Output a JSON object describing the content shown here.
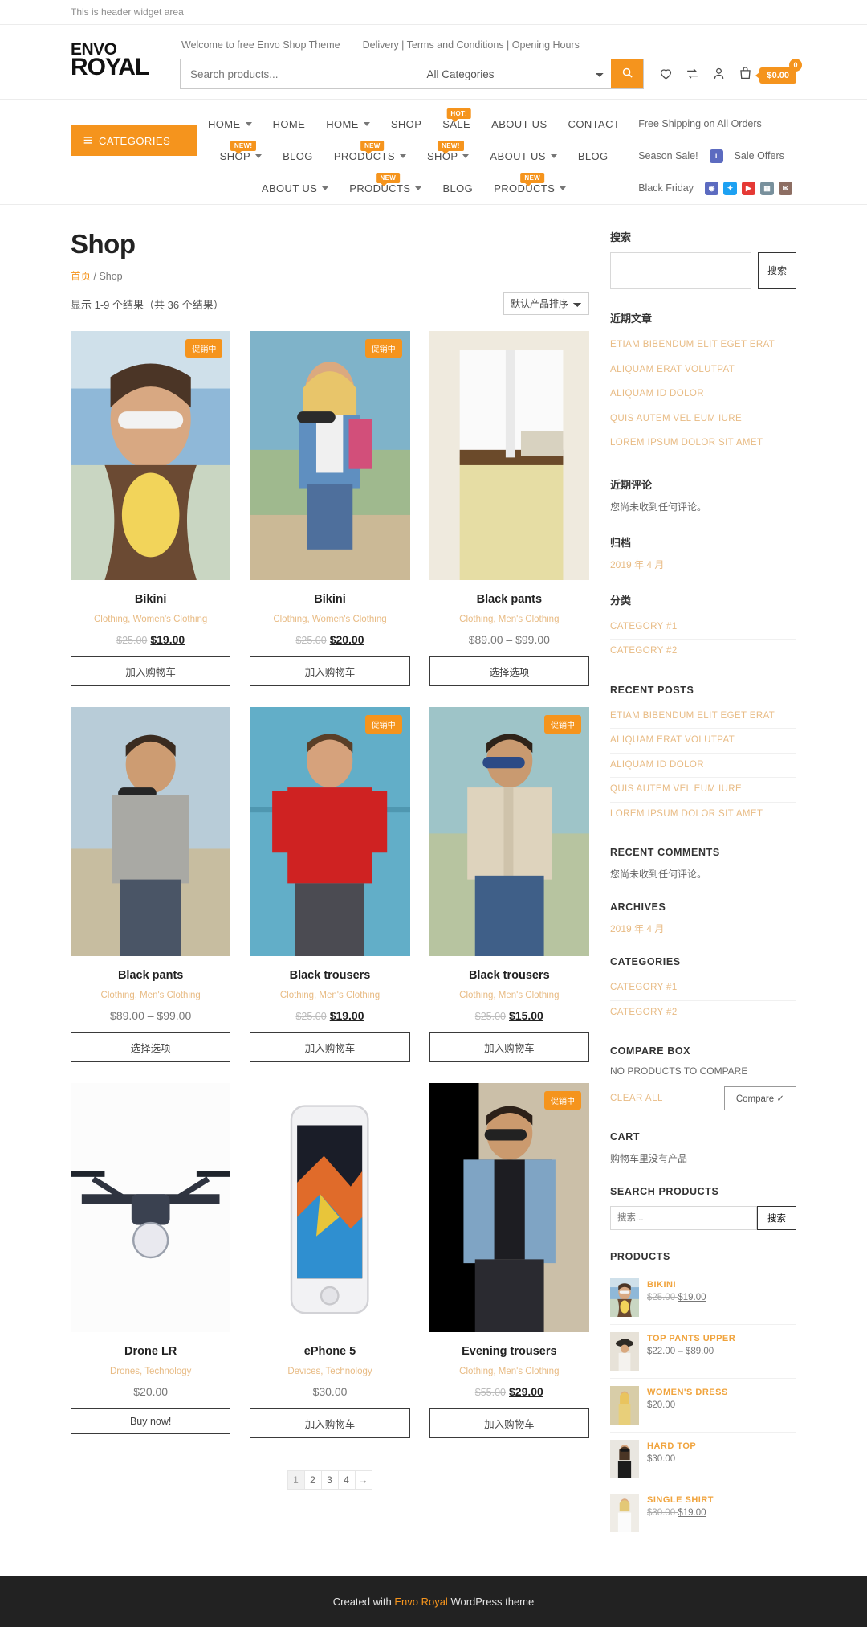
{
  "header_widget": {
    "text": "This is header widget area"
  },
  "logo": {
    "line1": "ENVO",
    "line2": "ROYAL"
  },
  "top_links": [
    {
      "label": "Welcome to free Envo Shop Theme"
    },
    {
      "label": "Delivery | Terms and Conditions | Opening Hours"
    }
  ],
  "search": {
    "placeholder": "Search products...",
    "category_selected": "All Categories",
    "button_icon": "search-icon"
  },
  "header_icons": {
    "wishlist": "heart-icon",
    "compare": "compare-icon",
    "account": "user-icon",
    "cart": "cart-icon",
    "cart_count": "0",
    "cart_total": "$0.00"
  },
  "categories_button": {
    "label": "CATEGORIES",
    "icon": "list-icon"
  },
  "nav": {
    "row1": [
      {
        "label": "HOME",
        "caret": true
      },
      {
        "label": "HOME",
        "caret": false
      },
      {
        "label": "HOME",
        "caret": true
      },
      {
        "label": "SHOP",
        "caret": false
      },
      {
        "label": "SALE",
        "caret": false,
        "badge": "HOT!"
      },
      {
        "label": "ABOUT US",
        "caret": false
      },
      {
        "label": "CONTACT",
        "caret": false
      }
    ],
    "row2": [
      {
        "label": "SHOP",
        "caret": true,
        "badge": "NEW!"
      },
      {
        "label": "BLOG",
        "caret": false
      },
      {
        "label": "PRODUCTS",
        "caret": true,
        "badge": "NEW"
      },
      {
        "label": "SHOP",
        "caret": true,
        "badge": "NEW!"
      },
      {
        "label": "ABOUT US",
        "caret": true
      },
      {
        "label": "BLOG",
        "caret": false
      }
    ],
    "row3": [
      {
        "label": "ABOUT US",
        "caret": true
      },
      {
        "label": "PRODUCTS",
        "caret": true,
        "badge": "NEW"
      },
      {
        "label": "BLOG",
        "caret": false
      },
      {
        "label": "PRODUCTS",
        "caret": true,
        "badge": "NEW"
      }
    ],
    "right1": [
      {
        "label": "Free Shipping on All Orders"
      }
    ],
    "right2": [
      {
        "label": "Season Sale!"
      },
      {
        "label": "Sale Offers"
      }
    ],
    "right3": [
      {
        "label": "Black Friday"
      }
    ],
    "social": [
      {
        "name": "instagram-icon",
        "glyph": "◉",
        "color": "#5c6bc0"
      },
      {
        "name": "twitter-icon",
        "glyph": "✦",
        "color": "#1da1f2"
      },
      {
        "name": "youtube-icon",
        "glyph": "▶",
        "color": "#e53935"
      },
      {
        "name": "rss-icon",
        "glyph": "▦",
        "color": "#78909c"
      },
      {
        "name": "mail-icon",
        "glyph": "✉",
        "color": "#8d6e63"
      }
    ]
  },
  "page": {
    "title": "Shop",
    "breadcrumb_home": "首页",
    "breadcrumb_sep": " / ",
    "breadcrumb_current": "Shop",
    "result_count": "显示 1-9 个结果（共 36 个结果）",
    "sort_selected": "默认产品排序"
  },
  "sale_badge_label": "促销中",
  "products": [
    {
      "name": "Bikini",
      "categories": "Clothing,  Women's Clothing",
      "price_old": "$25.00",
      "price_new": "$19.00",
      "price_range": "",
      "button": "加入购物车",
      "on_sale": true,
      "image": "woman-sunglasses-yellow-bikini"
    },
    {
      "name": "Bikini",
      "categories": "Clothing,  Women's Clothing",
      "price_old": "$25.00",
      "price_new": "$20.00",
      "price_range": "",
      "button": "加入购物车",
      "on_sale": true,
      "image": "blonde-woman-denim-beach"
    },
    {
      "name": "Black pants",
      "categories": "Clothing,  Men's Clothing",
      "price_old": "",
      "price_new": "",
      "price_range": "$89.00 – $99.00",
      "button": "选择选项",
      "on_sale": false,
      "image": "man-white-shirt-yellow-pants"
    },
    {
      "name": "Black pants",
      "categories": "Clothing,  Men's Clothing",
      "price_old": "",
      "price_new": "",
      "price_range": "$89.00 – $99.00",
      "button": "选择选项",
      "on_sale": false,
      "image": "man-grey-henley-beach"
    },
    {
      "name": "Black trousers",
      "categories": "Clothing,  Men's Clothing",
      "price_old": "$25.00",
      "price_new": "$19.00",
      "price_range": "",
      "button": "加入购物车",
      "on_sale": true,
      "image": "man-red-sweater-blue-wall"
    },
    {
      "name": "Black trousers",
      "categories": "Clothing,  Men's Clothing",
      "price_old": "$25.00",
      "price_new": "$15.00",
      "price_range": "",
      "button": "加入购物车",
      "on_sale": true,
      "image": "man-beige-shirt-sunglasses"
    },
    {
      "name": "Drone LR",
      "categories": "Drones,  Technology",
      "price_old": "",
      "price_new": "",
      "price_range": "$20.00",
      "button": "Buy now!",
      "on_sale": false,
      "image": "white-quadcopter-drone"
    },
    {
      "name": "ePhone 5",
      "categories": "Devices,  Technology",
      "price_old": "",
      "price_new": "",
      "price_range": "$30.00",
      "button": "加入购物车",
      "on_sale": false,
      "image": "white-smartphone-colorful-screen"
    },
    {
      "name": "Evening trousers",
      "categories": "Clothing,  Men's Clothing",
      "price_old": "$55.00",
      "price_new": "$29.00",
      "price_range": "",
      "button": "加入购物车",
      "on_sale": true,
      "image": "man-denim-jacket-sunglasses"
    }
  ],
  "pagination": {
    "pages": [
      "1",
      "2",
      "3",
      "4"
    ],
    "current": "1",
    "next_glyph": "→"
  },
  "sidebar": {
    "search_cn": {
      "title": "搜索",
      "value": "",
      "button": "搜索"
    },
    "recent_posts_cn": {
      "title": "近期文章",
      "items": [
        "ETIAM BIBENDUM ELIT EGET ERAT",
        "ALIQUAM ERAT VOLUTPAT",
        "ALIQUAM ID DOLOR",
        "QUIS AUTEM VEL EUM IURE",
        "LOREM IPSUM DOLOR SIT AMET"
      ]
    },
    "recent_comments_cn": {
      "title": "近期评论",
      "text": "您尚未收到任何评论。"
    },
    "archives_cn": {
      "title": "归档",
      "items": [
        "2019 年 4 月"
      ]
    },
    "categories_cn": {
      "title": "分类",
      "items": [
        "CATEGORY #1",
        "CATEGORY #2"
      ]
    },
    "recent_posts": {
      "title": "RECENT POSTS",
      "items": [
        "ETIAM BIBENDUM ELIT EGET ERAT",
        "ALIQUAM ERAT VOLUTPAT",
        "ALIQUAM ID DOLOR",
        "QUIS AUTEM VEL EUM IURE",
        "LOREM IPSUM DOLOR SIT AMET"
      ]
    },
    "recent_comments": {
      "title": "RECENT COMMENTS",
      "text": "您尚未收到任何评论。"
    },
    "archives": {
      "title": "ARCHIVES",
      "items": [
        "2019 年 4 月"
      ]
    },
    "categories": {
      "title": "CATEGORIES",
      "items": [
        "CATEGORY #1",
        "CATEGORY #2"
      ]
    },
    "compare_box": {
      "title": "COMPARE BOX",
      "empty_text": "NO PRODUCTS TO COMPARE",
      "clear_all": "CLEAR ALL",
      "compare_button": "Compare ✓"
    },
    "cart": {
      "title": "CART",
      "empty_text": "购物车里没有产品"
    },
    "search_products": {
      "title": "SEARCH PRODUCTS",
      "placeholder": "搜索...",
      "button": "搜索"
    },
    "products_widget": {
      "title": "PRODUCTS",
      "items": [
        {
          "name": "BIKINI",
          "price_old": "$25.00",
          "price_new": "$19.00",
          "price_plain": "",
          "image": "woman-sunglasses-yellow-bikini"
        },
        {
          "name": "TOP PANTS UPPER",
          "price_old": "",
          "price_new": "",
          "price_plain": "$22.00 – $89.00",
          "image": "woman-hat-white-top"
        },
        {
          "name": "WOMEN'S DRESS",
          "price_old": "",
          "price_new": "",
          "price_plain": "$20.00",
          "image": "blonde-woman-yellow-dress"
        },
        {
          "name": "HARD TOP",
          "price_old": "",
          "price_new": "",
          "price_plain": "$30.00",
          "image": "woman-sunglasses-black-top"
        },
        {
          "name": "SINGLE SHIRT",
          "price_old": "$30.00",
          "price_new": "$19.00",
          "price_plain": "",
          "image": "blonde-woman-white-shirt"
        }
      ]
    }
  },
  "footer": {
    "prefix": "Created with ",
    "brand": "Envo Royal",
    "suffix": " WordPress theme"
  }
}
